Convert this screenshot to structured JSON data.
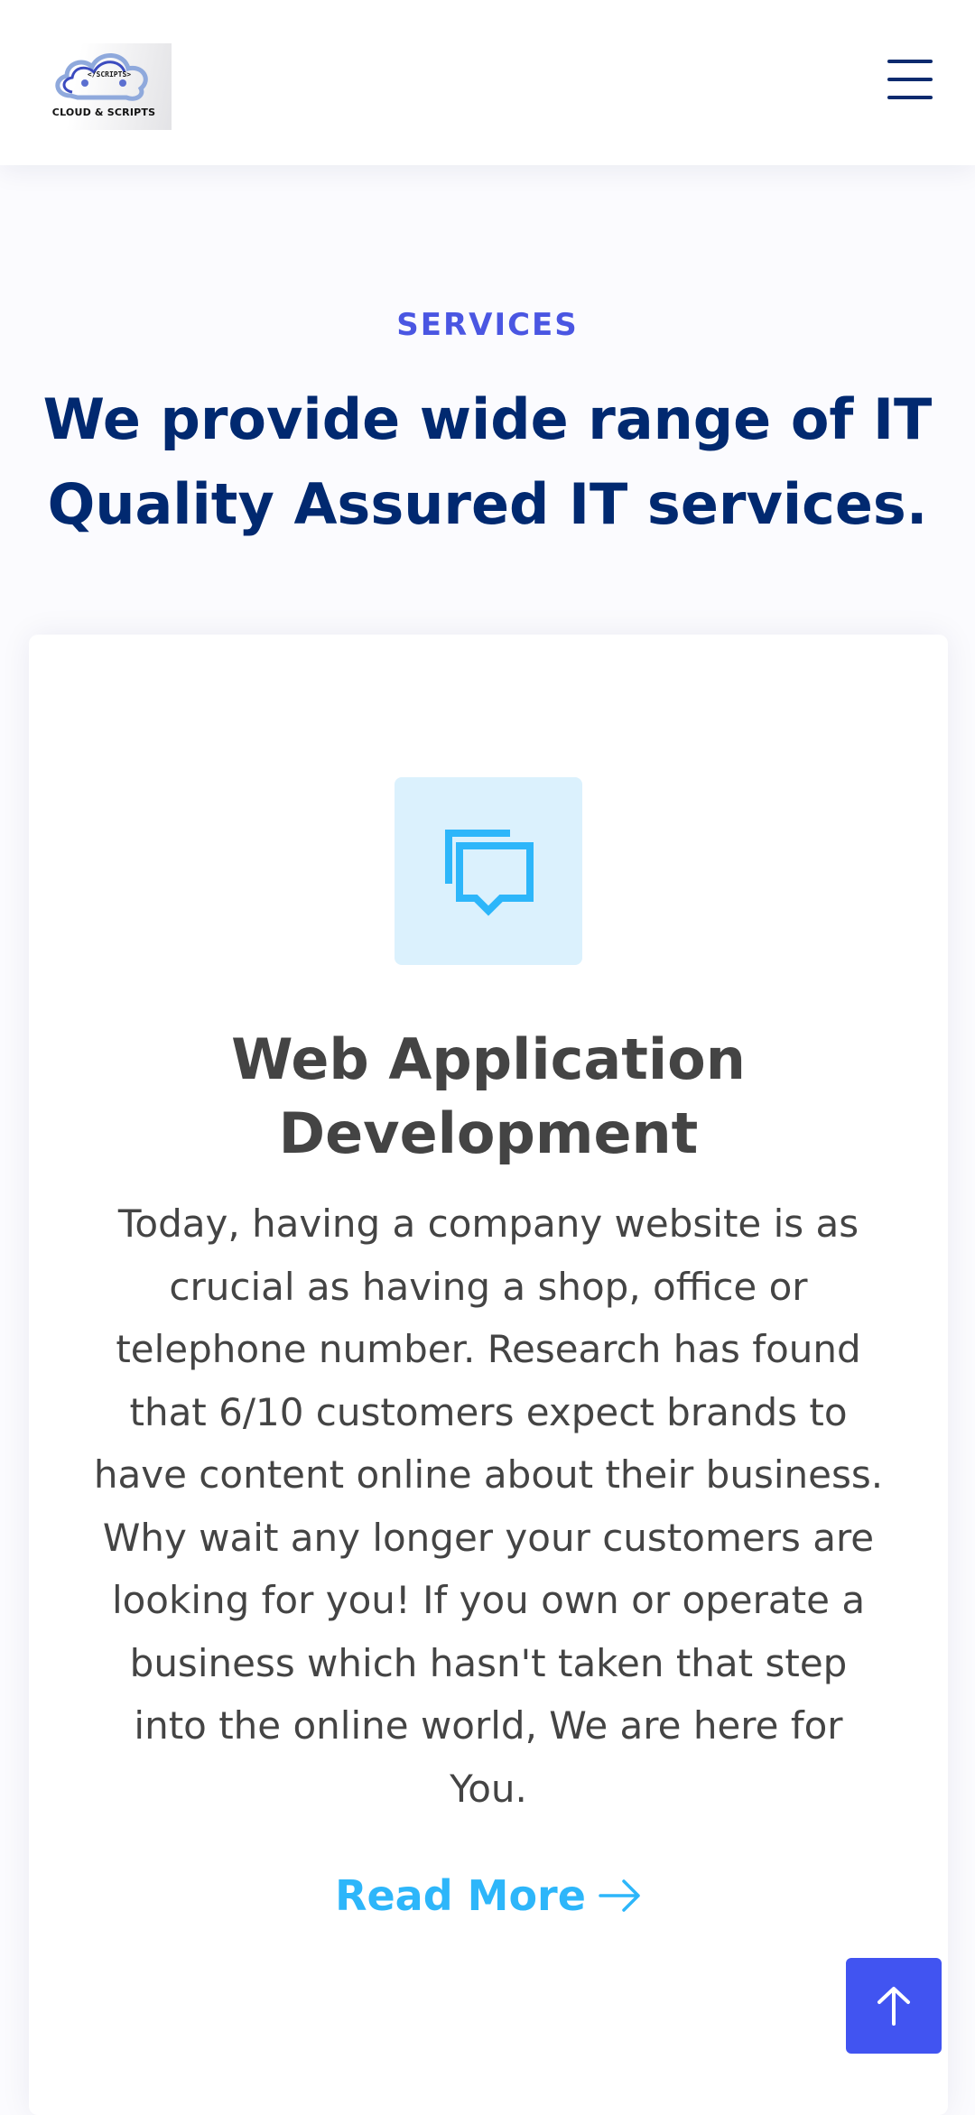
{
  "header": {
    "logo": {
      "script_text": "</SCRIPTS>",
      "brand_text": "CLOUD & SCRIPTS"
    },
    "menu_icon": "hamburger-menu-icon"
  },
  "section": {
    "eyebrow": "SERVICES",
    "title": "We provide wide range of IT Quality Assured IT services."
  },
  "card": {
    "icon": "chat-bubbles-icon",
    "title": "Web Application Development",
    "description": "Today, having a company website is as crucial as having a shop, office or telephone number. Research has found that 6/10 customers expect brands to have content online about their business. Why wait any longer your customers are looking for you! If you own or operate a business which hasn't taken that step into the online world, We are here for You.",
    "read_more_label": "Read More",
    "read_more_icon": "arrow-right-icon"
  },
  "back_to_top": {
    "icon": "arrow-up-icon"
  },
  "colors": {
    "accent": "#4154f1",
    "heading": "#012970",
    "eyebrow": "#4a56e2",
    "link": "#2db6fa",
    "icon_bg": "#dbf1fd",
    "body_text": "#444444"
  }
}
